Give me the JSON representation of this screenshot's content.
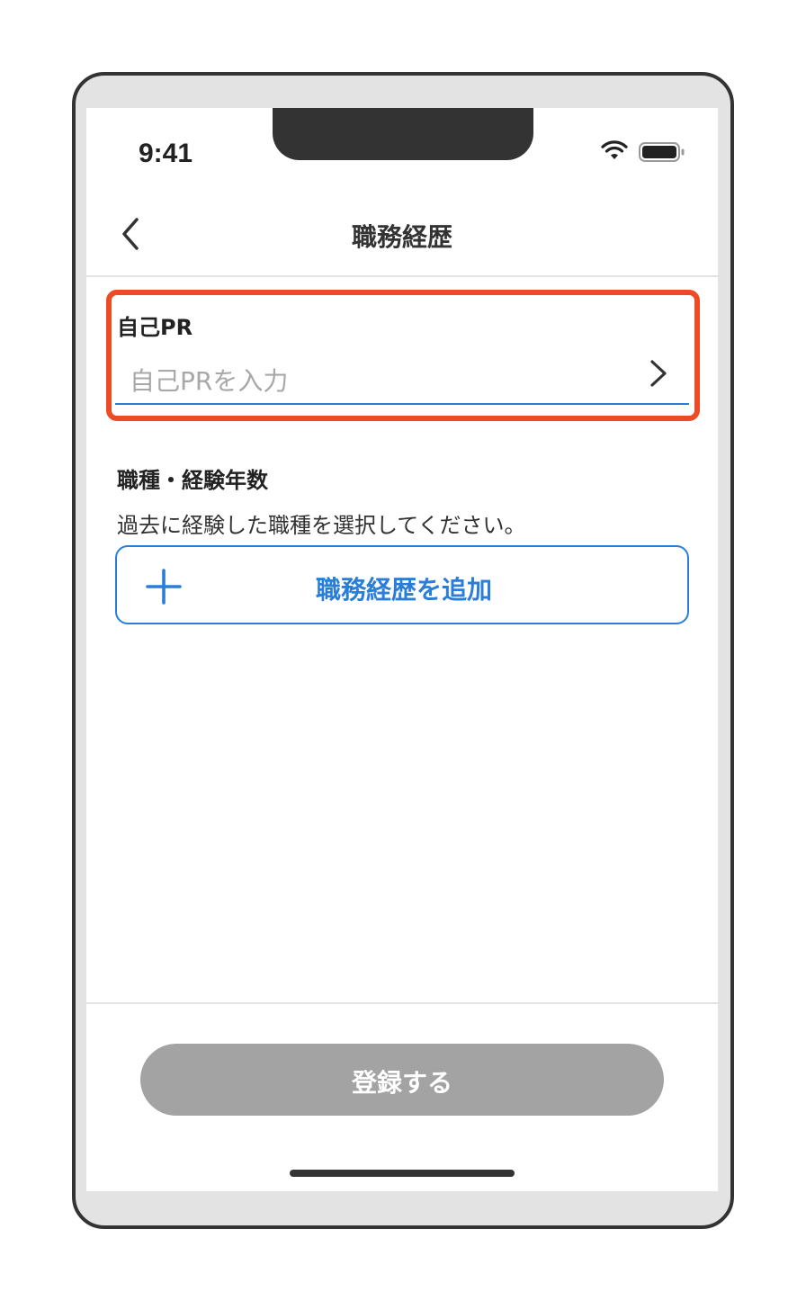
{
  "status_bar": {
    "time": "9:41"
  },
  "header": {
    "title": "職務経歴",
    "back_icon": "chevron-left-icon"
  },
  "self_pr": {
    "label": "自己PR",
    "placeholder": "自己PRを入力",
    "highlight_color": "#ec4b24",
    "underline_color": "#2b7ed8"
  },
  "job_history": {
    "label": "職種・経験年数",
    "description": "過去に経験した職種を選択してください。",
    "add_button_label": "職務経歴を追加",
    "add_icon": "plus-icon",
    "accent_color": "#2b7ed8"
  },
  "footer": {
    "submit_label": "登録する",
    "submit_color": "#a3a3a3"
  }
}
